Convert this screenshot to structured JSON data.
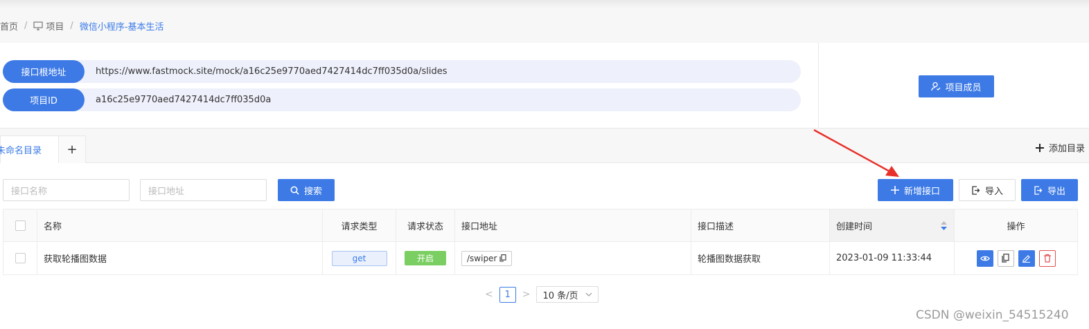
{
  "breadcrumb": {
    "home": "首页",
    "project": "项目",
    "current": "微信小程序-基本生活",
    "separator": "/"
  },
  "info": {
    "root_label": "接口根地址",
    "root_value": "https://www.fastmock.site/mock/a16c25e9770aed7427414dc7ff035d0a/slides",
    "id_label": "项目ID",
    "id_value": "a16c25e9770aed7427414dc7ff035d0a",
    "members_button": "项目成员"
  },
  "tabs": {
    "active": "未命名目录",
    "add_tab": "+",
    "add_directory": "添加目录"
  },
  "search": {
    "name_placeholder": "接口名称",
    "url_placeholder": "接口地址",
    "search_button": "搜索",
    "new_api_button": "新增接口",
    "import_button": "导入",
    "export_button": "导出"
  },
  "table": {
    "headers": [
      "名称",
      "请求类型",
      "请求状态",
      "接口地址",
      "接口描述",
      "创建时间",
      "操作"
    ],
    "rows": [
      {
        "name": "获取轮播图数据",
        "method": "get",
        "status": "开启",
        "url": "/swiper",
        "description": "轮播图数据获取",
        "created": "2023-01-09 11:33:44"
      }
    ]
  },
  "pagination": {
    "prev": "<",
    "page": "1",
    "next": ">",
    "page_size": "10 条/页"
  },
  "watermark": "CSDN @weixin_54515240",
  "colors": {
    "primary": "#3d7ae6",
    "success": "#7bcf62",
    "danger": "#e24d4d",
    "annotation_arrow": "#e8302a"
  }
}
